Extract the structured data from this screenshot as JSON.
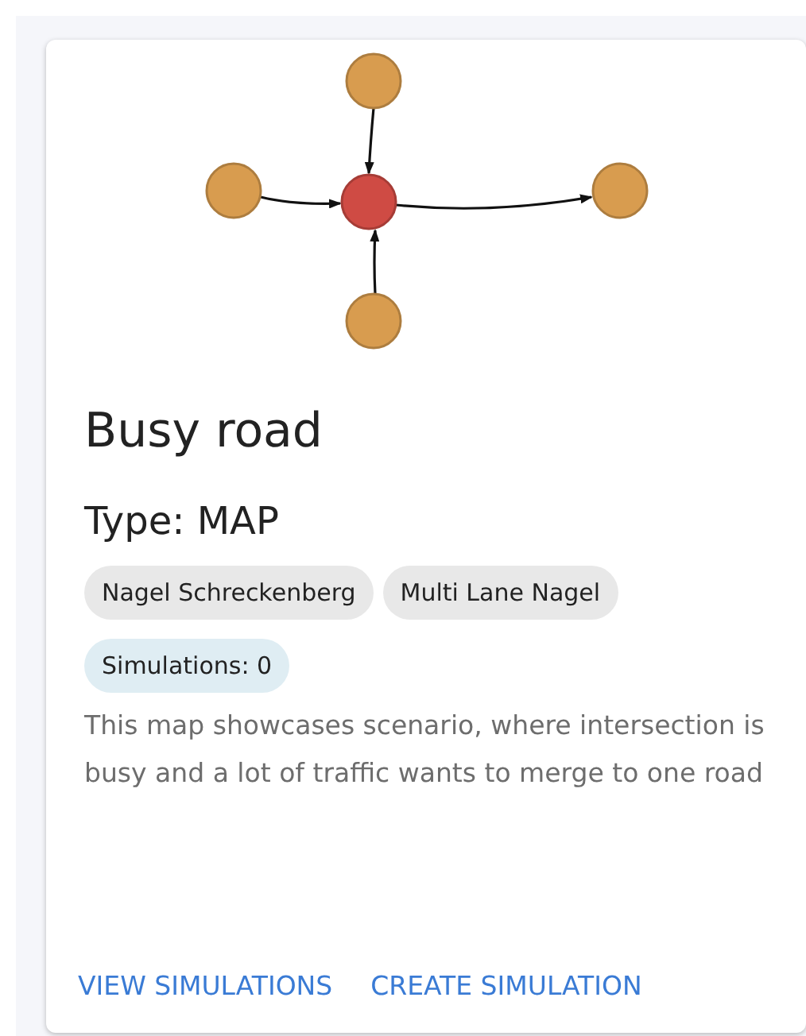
{
  "graph": {
    "nodes": [
      {
        "color": "#d89c4f"
      },
      {
        "color": "#d89c4f"
      },
      {
        "color": "#cf4b44"
      },
      {
        "color": "#d89c4f"
      },
      {
        "color": "#d89c4f"
      }
    ]
  },
  "card": {
    "title": "Busy road",
    "type": "Type: MAP",
    "tags": [
      "Nagel Schreckenberg",
      "Multi Lane Nagel"
    ],
    "simulations": "Simulations: 0",
    "description": "This map showcases scenario, where intersection is busy and a lot of traffic wants to merge to one road",
    "actions": [
      "VIEW SIMULATIONS",
      "CREATE SIMULATION"
    ]
  }
}
